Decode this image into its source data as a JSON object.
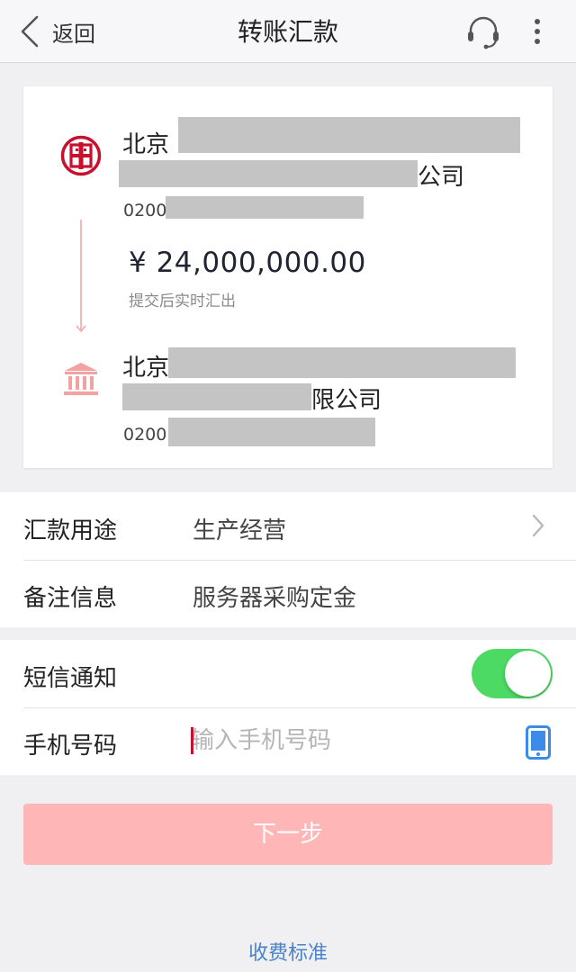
{
  "nav": {
    "back_label": "返回",
    "title": "转账汇款"
  },
  "transfer": {
    "payer": {
      "name_line1": "北京",
      "name_line2": "公司",
      "account_prefix": "0200"
    },
    "amount": "¥ 24,000,000.00",
    "amount_note": "提交后实时汇出",
    "payee": {
      "name_line1": "北京",
      "name_line2": "限公司",
      "account_prefix": "0200"
    }
  },
  "form": {
    "purpose_label": "汇款用途",
    "purpose_value": "生产经营",
    "remark_label": "备注信息",
    "remark_value": "服务器采购定金",
    "sms_label": "短信通知",
    "sms_enabled": true,
    "phone_label": "手机号码",
    "phone_placeholder": "输入手机号码"
  },
  "next_button": "下一步",
  "fee_link": "收费标准",
  "colors": {
    "icbc_red": "#c8102e",
    "toggle_on": "#4cd964",
    "button_disabled": "#ffb6b6",
    "link_blue": "#4a82c8",
    "phone_icon_blue": "#3d8be8"
  },
  "icons": [
    "chevron-left-icon",
    "headset-icon",
    "more-vertical-icon",
    "icbc-logo-icon",
    "bank-building-icon",
    "arrow-down-icon",
    "chevron-right-icon",
    "mobile-phone-icon"
  ]
}
